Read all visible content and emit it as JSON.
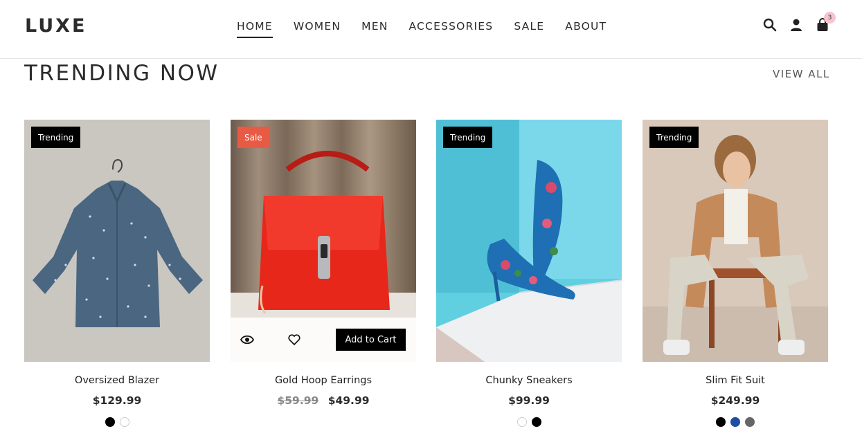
{
  "header": {
    "logo": "LUXE",
    "nav": [
      "HOME",
      "WOMEN",
      "MEN",
      "ACCESSORIES",
      "SALE",
      "ABOUT"
    ],
    "active_nav": "HOME",
    "cart_count": "3",
    "icons": [
      "search-icon",
      "user-icon",
      "shopping-bag-icon"
    ]
  },
  "section": {
    "title": "TRENDING NOW",
    "view_all": "VIEW ALL"
  },
  "products": [
    {
      "name": "Oversized Blazer",
      "badge": "Trending",
      "price": "$129.99",
      "old_price": "",
      "swatches": [
        "#000000",
        "#ffffff"
      ]
    },
    {
      "name": "Gold Hoop Earrings",
      "badge": "Sale",
      "price": "$49.99",
      "old_price": "$59.99",
      "swatches": [],
      "hover_actions": {
        "add_to_cart": "Add to Cart"
      }
    },
    {
      "name": "Chunky Sneakers",
      "badge": "Trending",
      "price": "$99.99",
      "old_price": "",
      "swatches": [
        "#ffffff",
        "#000000"
      ]
    },
    {
      "name": "Slim Fit Suit",
      "badge": "Trending",
      "price": "$249.99",
      "old_price": "",
      "swatches": [
        "#000000",
        "#1e4ea0",
        "#666666"
      ]
    }
  ],
  "colors": {
    "sale_badge": "#e85a44",
    "trending_badge": "#000000",
    "cart_badge": "#f4c4cf"
  }
}
